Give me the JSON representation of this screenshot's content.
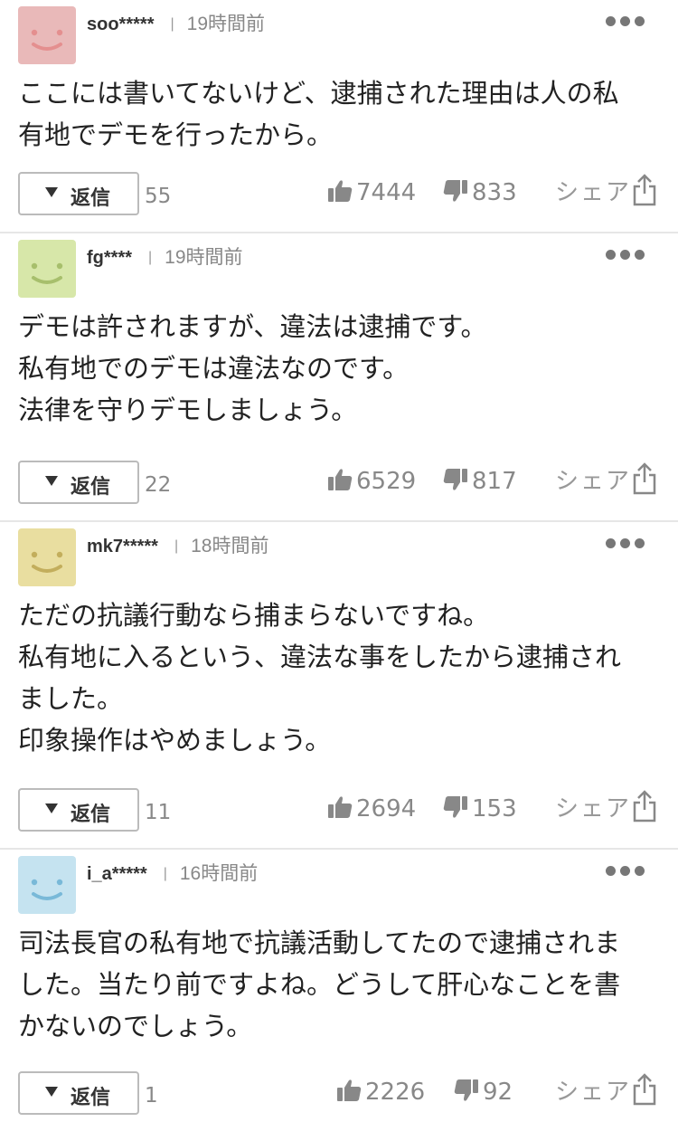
{
  "comments": [
    {
      "user": "soo*****",
      "time": "19時間前",
      "avatar_color": "#e9b9b9",
      "avatar_face": "#e48f8f",
      "lines": [
        "ここには書いてないけど、逮捕された理由は人の私",
        "有地でデモを行ったから。"
      ],
      "reply_label": "返信",
      "reply_count": "55",
      "likes": "7444",
      "dislikes": "833",
      "share_label": "シェア"
    },
    {
      "user": "fg****",
      "time": "19時間前",
      "avatar_color": "#d7e7a9",
      "avatar_face": "#a7bf6c",
      "lines": [
        "デモは許されますが、違法は逮捕です。",
        "私有地でのデモは違法なのです。",
        "法律を守りデモしましょう。"
      ],
      "reply_label": "返信",
      "reply_count": "22",
      "likes": "6529",
      "dislikes": "817",
      "share_label": "シェア"
    },
    {
      "user": "mk7*****",
      "time": "18時間前",
      "avatar_color": "#e9dea0",
      "avatar_face": "#c3ae5c",
      "lines": [
        "ただの抗議行動なら捕まらないですね。",
        "私有地に入るという、違法な事をしたから逮捕され",
        "ました。",
        "印象操作はやめましょう。"
      ],
      "reply_label": "返信",
      "reply_count": "11",
      "likes": "2694",
      "dislikes": "153",
      "share_label": "シェア"
    },
    {
      "user": "i_a*****",
      "time": "16時間前",
      "avatar_color": "#c5e3f0",
      "avatar_face": "#79b9d8",
      "lines": [
        "司法長官の私有地で抗議活動してたので逮捕されま",
        "した。当たり前ですよね。どうして肝心なことを書",
        "かないのでしょう。"
      ],
      "reply_label": "返信",
      "reply_count": "1",
      "likes": "2226",
      "dislikes": "92",
      "share_label": "シェア"
    }
  ],
  "icons": {
    "more": "more-dots-icon",
    "like": "thumbs-up-icon",
    "dislike": "thumbs-down-icon",
    "share": "share-icon",
    "reply": "triangle-down-icon"
  }
}
